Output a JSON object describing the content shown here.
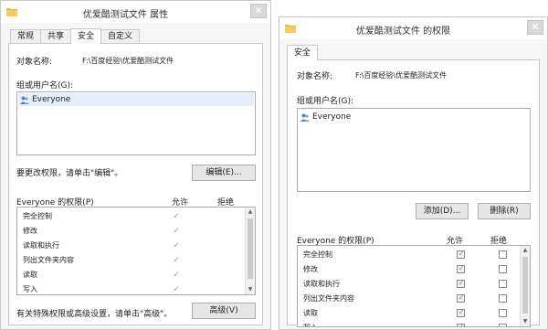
{
  "dialog1": {
    "title": "优爱酷测试文件 属性",
    "close_glyph": "✕",
    "tabs": [
      "常规",
      "共享",
      "安全",
      "自定义"
    ],
    "object_label": "对象名称:",
    "object_value": "F:\\百度经验\\优爱酷测试文件",
    "group_label": "组或用户名(G):",
    "users": [
      "Everyone"
    ],
    "change_hint": "要更改权限，请单击\"编辑\"。",
    "edit_button": "编辑(E)...",
    "perm_header": "Everyone 的权限(P)",
    "allow_header": "允许",
    "deny_header": "拒绝",
    "permissions": [
      {
        "name": "完全控制",
        "allow": "✓"
      },
      {
        "name": "修改",
        "allow": "✓"
      },
      {
        "name": "读取和执行",
        "allow": "✓"
      },
      {
        "name": "列出文件夹内容",
        "allow": "✓"
      },
      {
        "name": "读取",
        "allow": "✓"
      },
      {
        "name": "写入",
        "allow": "✓"
      }
    ],
    "advanced_hint": "有关特殊权限或高级设置，请单击\"高级\"。",
    "advanced_button": "高级(V)"
  },
  "dialog2": {
    "title": "优爱酷测试文件 的权限",
    "close_glyph": "✕",
    "tabs": [
      "安全"
    ],
    "object_label": "对象名称:",
    "object_value": "F:\\百度经验\\优爱酷测试文件",
    "group_label": "组或用户名(G):",
    "users": [
      "Everyone"
    ],
    "add_button": "添加(D)...",
    "remove_button": "删除(R)",
    "perm_header": "Everyone 的权限(P)",
    "allow_header": "允许",
    "deny_header": "拒绝",
    "permissions": [
      {
        "name": "完全控制",
        "allow": "✓"
      },
      {
        "name": "修改",
        "allow": "✓"
      },
      {
        "name": "读取和执行",
        "allow": "✓"
      },
      {
        "name": "列出文件夹内容",
        "allow": "✓"
      },
      {
        "name": "读取",
        "allow": "✓"
      },
      {
        "name": "写入",
        "allow": "✓"
      }
    ]
  },
  "icons": {
    "folder": "folder-icon",
    "user": "user-group-icon",
    "close": "close-icon",
    "scroll_up": "▲",
    "scroll_down": "▼"
  },
  "colors": {
    "window_bg": "#f6f6f6",
    "button_bg": "#e6e6e6",
    "border": "#adadad",
    "folder": "#e8b843"
  }
}
